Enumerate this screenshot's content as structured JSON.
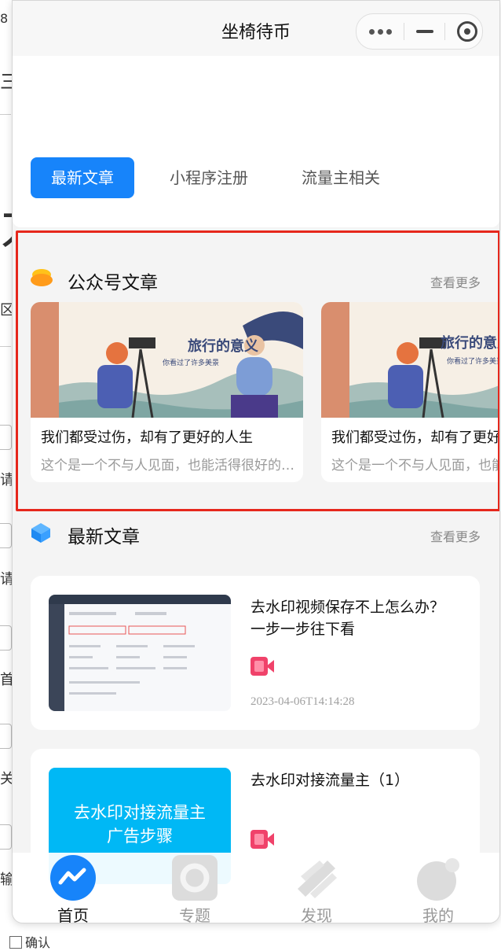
{
  "window": {
    "title": "坐椅待币"
  },
  "tabs": [
    {
      "label": "最新文章",
      "active": true
    },
    {
      "label": "小程序注册",
      "active": false
    },
    {
      "label": "流量主相关",
      "active": false
    }
  ],
  "wechat_section": {
    "title": "公众号文章",
    "more": "查看更多",
    "cards": [
      {
        "title": "我们都受过伤，却有了更好的人生",
        "desc": "这个是一个不与人见面，也能活得很好的人…",
        "image_text": "旅行的意义",
        "image_sub": "你看过了许多美景"
      },
      {
        "title": "我们都受过伤，却有了更好的人生",
        "desc": "这个是一个不与人见面，也能活得很好的人…",
        "image_text": "旅行的意义",
        "image_sub": "你看过了许多美景"
      }
    ]
  },
  "latest_section": {
    "title": "最新文章",
    "more": "查看更多",
    "articles": [
      {
        "title": "去水印视频保存不上怎么办？一步一步往下看",
        "date": "2023-04-06T14:14:28",
        "icon": "video-icon"
      },
      {
        "title": "去水印对接流量主（1）",
        "thumb_text": "去水印对接流量主\n广告步骤",
        "icon": "video-icon"
      }
    ]
  },
  "tabbar": [
    {
      "label": "首页",
      "icon": "home-icon",
      "active": true
    },
    {
      "label": "专题",
      "icon": "topic-icon",
      "active": false
    },
    {
      "label": "发现",
      "icon": "discover-icon",
      "active": false
    },
    {
      "label": "我的",
      "icon": "profile-icon",
      "active": false
    }
  ],
  "background_page": {
    "confirm_label": "确认"
  },
  "colors": {
    "accent": "#1784fa",
    "highlight": "#e6271c",
    "video": "#f0426a"
  }
}
